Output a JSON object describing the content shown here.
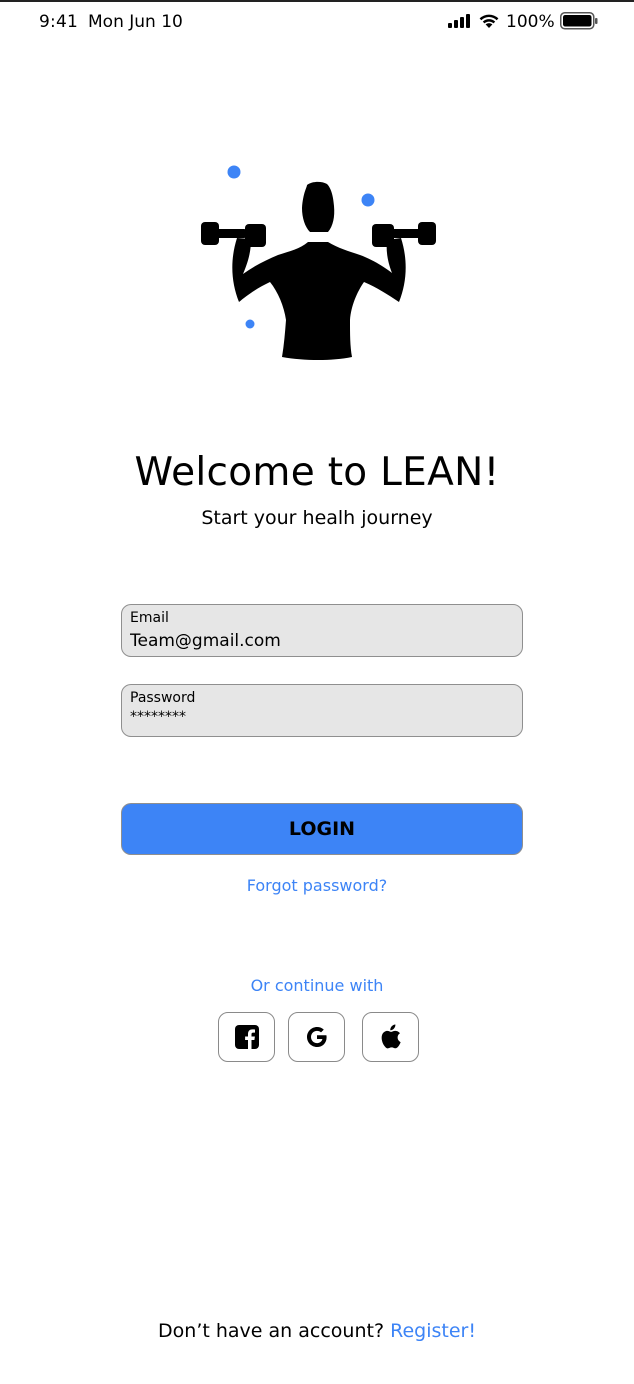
{
  "status_bar": {
    "time": "9:41",
    "date": "Mon Jun 10",
    "battery_percent": "100%"
  },
  "illustration": {
    "name": "woman-lifting-dumbbells",
    "accent_color": "#3d84f6"
  },
  "welcome": {
    "title": "Welcome to LEAN!",
    "subtitle": "Start your healh journey"
  },
  "form": {
    "email": {
      "label": "Email",
      "value": "Team@gmail.com"
    },
    "password": {
      "label": "Password",
      "value": "********"
    },
    "login_label": "LOGIN",
    "forgot_label": "Forgot password?"
  },
  "social": {
    "heading": "Or continue with",
    "providers": [
      "facebook-icon",
      "google-icon",
      "apple-icon"
    ]
  },
  "footer": {
    "prompt": "Don’t have an account?",
    "register_label": "Register!"
  },
  "colors": {
    "accent": "#3d84f6",
    "field_background": "#e6e6e6",
    "field_border": "#8f8f8f"
  }
}
